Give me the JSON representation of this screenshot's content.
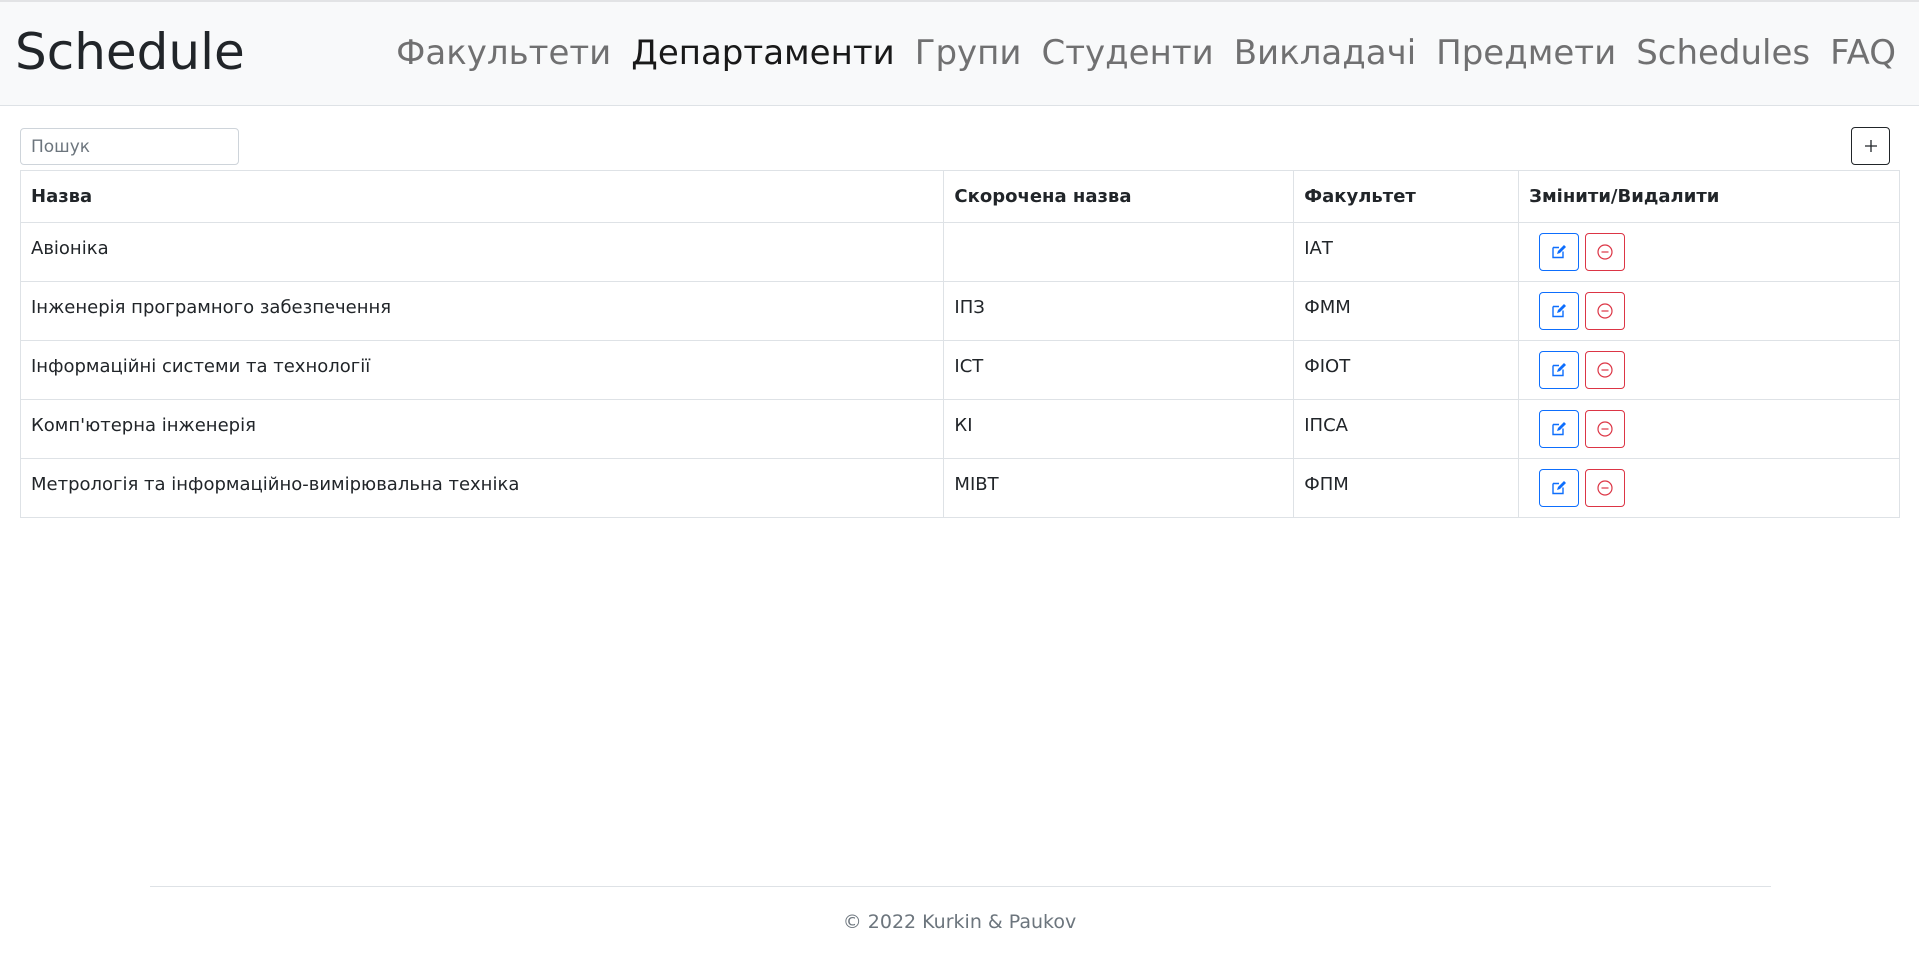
{
  "navbar": {
    "brand": "Schedule",
    "links": [
      {
        "label": "Факультети",
        "active": false
      },
      {
        "label": "Департаменти",
        "active": true
      },
      {
        "label": "Групи",
        "active": false
      },
      {
        "label": "Студенти",
        "active": false
      },
      {
        "label": "Викладачі",
        "active": false
      },
      {
        "label": "Предмети",
        "active": false
      },
      {
        "label": "Schedules",
        "active": false
      },
      {
        "label": "FAQ",
        "active": false
      }
    ]
  },
  "toolbar": {
    "search_placeholder": "Пошук",
    "search_value": "",
    "add_icon": "plus-icon"
  },
  "table": {
    "headers": [
      "Назва",
      "Скорочена назва",
      "Факультет",
      "Змінити/Видалити"
    ],
    "rows": [
      {
        "name": "Авіоніка",
        "short": "",
        "faculty": "ІАТ"
      },
      {
        "name": "Інженерія програмного забезпечення",
        "short": "ІПЗ",
        "faculty": "ФММ"
      },
      {
        "name": "Інформаційні системи та технології",
        "short": "ІСТ",
        "faculty": "ФІОТ"
      },
      {
        "name": "Комп'ютерна інженерія",
        "short": "КІ",
        "faculty": "ІПСА"
      },
      {
        "name": "Метрологія та інформаційно-вимірювальна техніка",
        "short": "МІВТ",
        "faculty": "ФПМ"
      }
    ],
    "edit_icon": "edit-icon",
    "delete_icon": "remove-icon"
  },
  "footer": {
    "text": "© 2022 Kurkin & Paukov"
  },
  "colors": {
    "edit": "#0d6efd",
    "delete": "#dc3545",
    "navbar_bg": "#f8f9fa"
  }
}
